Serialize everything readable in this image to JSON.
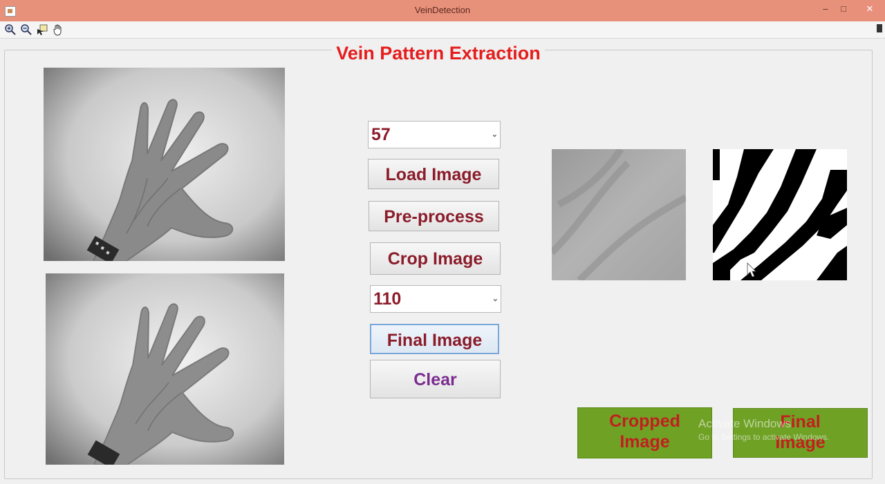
{
  "window": {
    "title": "VeinDetection",
    "minimize": "–",
    "maximize": "□",
    "close": "✕"
  },
  "toolbar": {
    "tools": [
      "zoom-in-icon",
      "zoom-out-icon",
      "data-cursor-icon",
      "pan-hand-icon"
    ]
  },
  "panel": {
    "title": "Vein Pattern Extraction"
  },
  "controls": {
    "select_1": {
      "value": "57"
    },
    "select_2": {
      "value": "110"
    },
    "load_label": "Load Image",
    "preprocess_label": "Pre-process",
    "crop_label": "Crop Image",
    "final_label": "Final Image",
    "clear_label": "Clear"
  },
  "outputs": {
    "cropped_line1": "Cropped",
    "cropped_line2": "Image",
    "final_line1": "Final",
    "final_line2": "Image"
  },
  "watermark": {
    "line1": "Activate Windows",
    "line2": "Go to Settings to activate Windows."
  },
  "colors": {
    "title_red": "#e51d1d",
    "label_maroon": "#8b1c2a",
    "clear_purple": "#7b2d8e",
    "green_button": "#6fa125",
    "titlebar": "#e8917a"
  }
}
